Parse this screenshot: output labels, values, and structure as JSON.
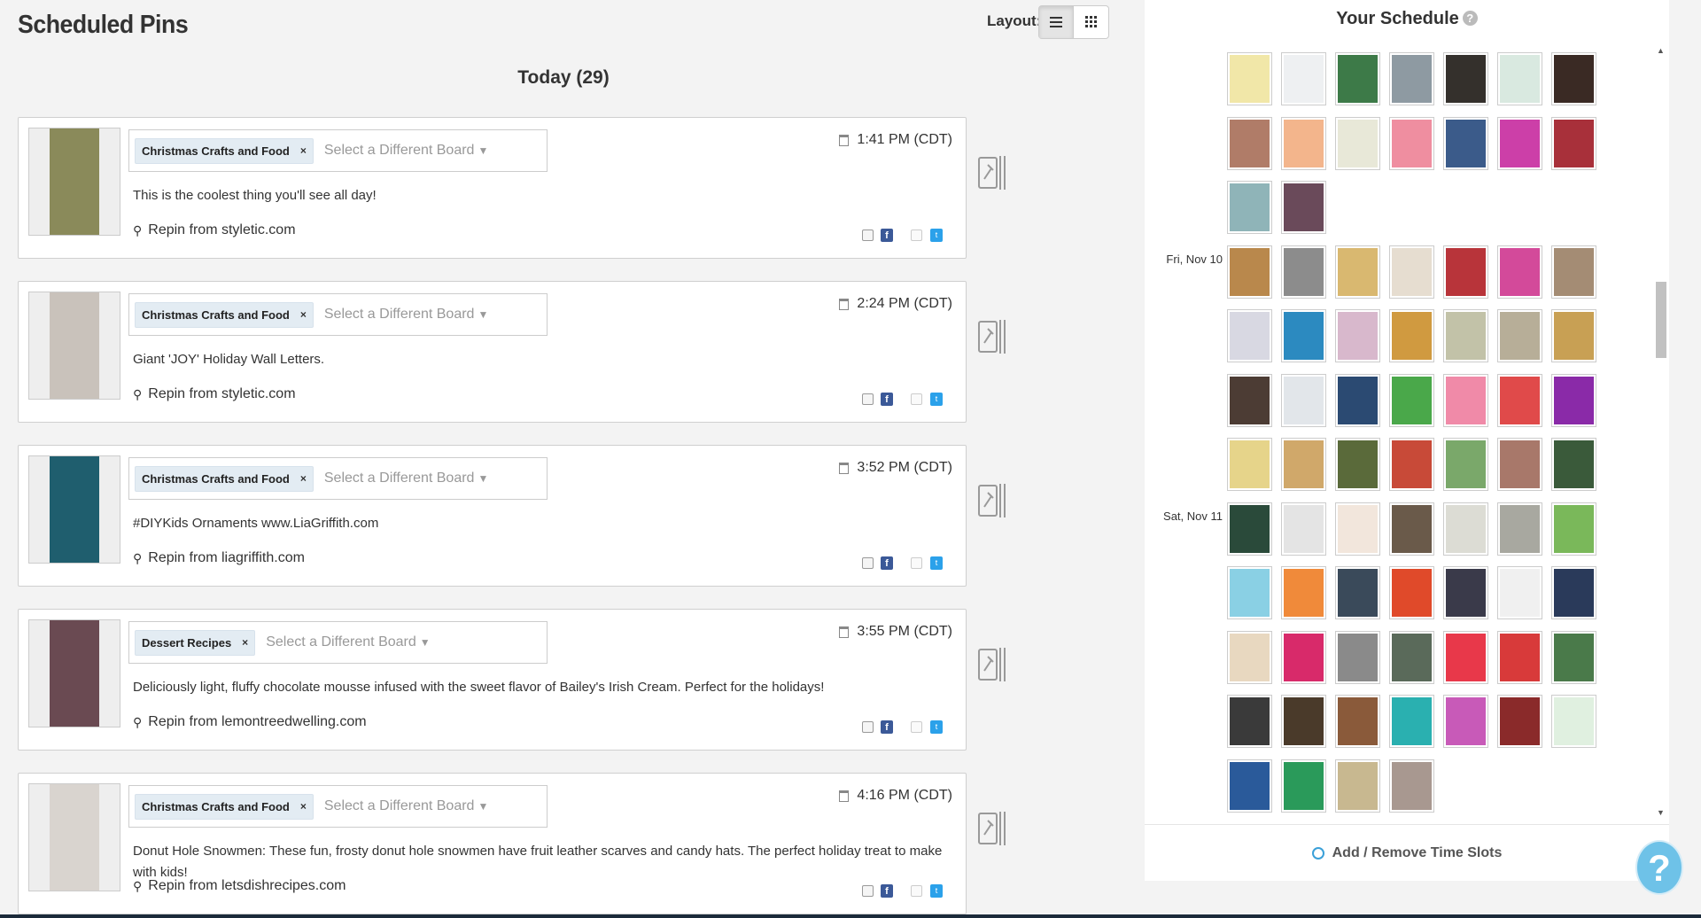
{
  "header": {
    "title": "Scheduled Pins",
    "layout_label": "Layout:",
    "layout_options": [
      "list-view",
      "grid-view"
    ],
    "layout_active": "list-view"
  },
  "day_heading": "Today (29)",
  "board_placeholder": "Select a Different Board",
  "remove_glyph": "×",
  "caret_glyph": "▼",
  "pin_glyph": "⚲",
  "pins": [
    {
      "board": "Christmas Crafts and Food",
      "time": "1:41 PM (CDT)",
      "description": "This is the coolest thing you'll see all day!",
      "source": "Repin from styletic.com",
      "thumb_color": "#8a8a5a"
    },
    {
      "board": "Christmas Crafts and Food",
      "time": "2:24 PM (CDT)",
      "description": "Giant 'JOY' Holiday Wall Letters.",
      "source": "Repin from styletic.com",
      "thumb_color": "#c9c2bb"
    },
    {
      "board": "Christmas Crafts and Food",
      "time": "3:52 PM (CDT)",
      "description": "#DIYKids Ornaments www.LiaGriffith.com",
      "source": "Repin from liagriffith.com",
      "thumb_color": "#1f5e6e"
    },
    {
      "board": "Dessert Recipes",
      "time": "3:55 PM (CDT)",
      "description": "Deliciously light, fluffy chocolate mousse infused with the sweet flavor of Bailey's Irish Cream. Perfect for the holidays!",
      "source": "Repin from lemontreedwelling.com",
      "thumb_color": "#6a4a52"
    },
    {
      "board": "Christmas Crafts and Food",
      "time": "4:16 PM (CDT)",
      "description": "Donut Hole Snowmen: These fun, frosty donut hole snowmen have fruit leather scarves and candy hats. The perfect holiday treat to make with kids!",
      "source": "Repin from letsdishrecipes.com",
      "thumb_color": "#d9d4cf"
    }
  ],
  "schedule": {
    "title": "Your Schedule",
    "help_glyph": "?",
    "days": [
      {
        "label": "Fri, Nov 10",
        "row": 3
      },
      {
        "label": "Sat, Nov 11",
        "row": 7
      }
    ],
    "rows": [
      [
        "#f1e7a8",
        "#eef0f2",
        "#3d7a48",
        "#8e9aa2",
        "#34302c",
        "#d9e9e0",
        "#3a2a24"
      ],
      [
        "#b07c68",
        "#f3b58c",
        "#e8e8d8",
        "#ef8ea0",
        "#3b5b8a",
        "#cc3fa8",
        "#a8303a"
      ],
      [
        "#8fb4b8",
        "#6a4a5a"
      ],
      [
        "#b9884c",
        "#8c8c8c",
        "#d9b870",
        "#e6ddd0",
        "#b8343a",
        "#d34a9a",
        "#a48c74"
      ],
      [
        "#d8d8e2",
        "#2c8ac0",
        "#d8b8cc",
        "#d09a40",
        "#c2c2a8",
        "#b7ae98",
        "#c8a054"
      ],
      [
        "#4c3c34",
        "#e2e6ea",
        "#2b4a72",
        "#4aa84a",
        "#f08aa8",
        "#e04a4a",
        "#8a2aa8"
      ],
      [
        "#e6d48a",
        "#d0a86a",
        "#5a6a3a",
        "#c84a38",
        "#7aa86a",
        "#a8786a",
        "#3a5a3a"
      ],
      [
        "#2a4a3a",
        "#e4e4e4",
        "#f2e6dc",
        "#6a5a4a",
        "#dcdcd4",
        "#a8a8a0",
        "#7ab85a"
      ],
      [
        "#8ad0e4",
        "#f08a3a",
        "#3a4a5a",
        "#e04a2a",
        "#3a3a4a",
        "#f0f0f0",
        "#2a3a5a"
      ],
      [
        "#e8d8c0",
        "#d82a6a",
        "#8a8a8a",
        "#5a6a5a",
        "#e8384a",
        "#d83a3a",
        "#4a7a4a"
      ],
      [
        "#3a3a3a",
        "#4a3a2a",
        "#8a5a3a",
        "#2ab0b0",
        "#c85ab8",
        "#8a2a2a",
        "#e0f0e0"
      ],
      [
        "#2a5a9a",
        "#2a9a5a",
        "#c8b890",
        "#a89890"
      ]
    ],
    "footer_label": "Add / Remove Time Slots"
  },
  "help_fab": "?"
}
